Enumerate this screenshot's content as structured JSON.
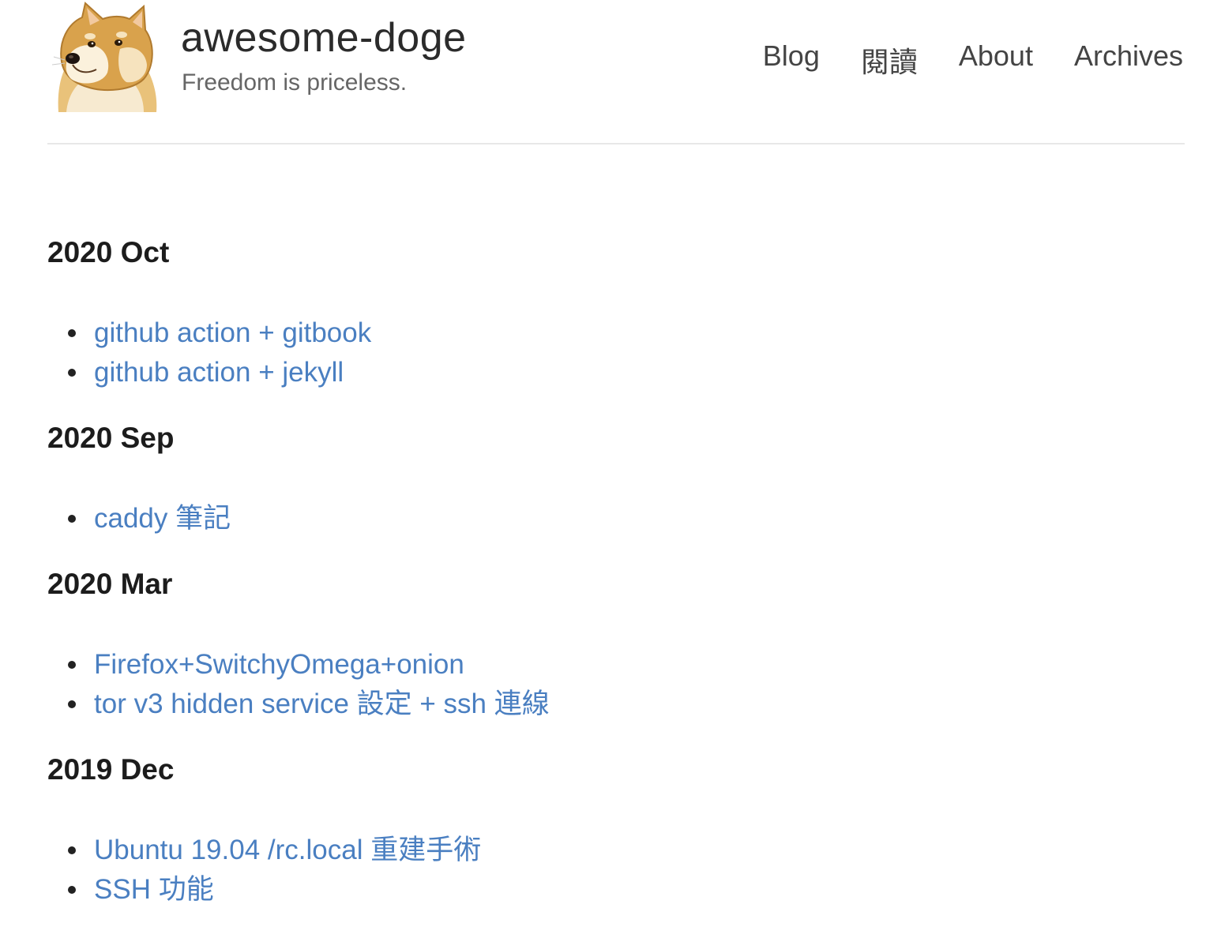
{
  "site": {
    "title": "awesome-doge",
    "description": "Freedom is priceless."
  },
  "nav": {
    "items": [
      {
        "label": "Blog"
      },
      {
        "label": "閱讀"
      },
      {
        "label": "About"
      },
      {
        "label": "Archives"
      }
    ]
  },
  "colors": {
    "link": "#4a7fc1",
    "heading": "#1c1c1c",
    "divider": "#e8e8e8"
  },
  "avatar": {
    "icon": "doge-avatar-icon"
  },
  "archive": {
    "months": [
      {
        "heading": "2020 Oct",
        "posts": [
          {
            "title": "github action + gitbook"
          },
          {
            "title": "github action + jekyll"
          }
        ]
      },
      {
        "heading": "2020 Sep",
        "posts": [
          {
            "title": "caddy 筆記"
          }
        ]
      },
      {
        "heading": "2020 Mar",
        "posts": [
          {
            "title": "Firefox+SwitchyOmega+onion"
          },
          {
            "title": "tor v3 hidden service 設定 + ssh 連線"
          }
        ]
      },
      {
        "heading": "2019 Dec",
        "posts": [
          {
            "title": "Ubuntu 19.04 /rc.local 重建手術"
          },
          {
            "title": "SSH 功能"
          }
        ]
      }
    ]
  }
}
